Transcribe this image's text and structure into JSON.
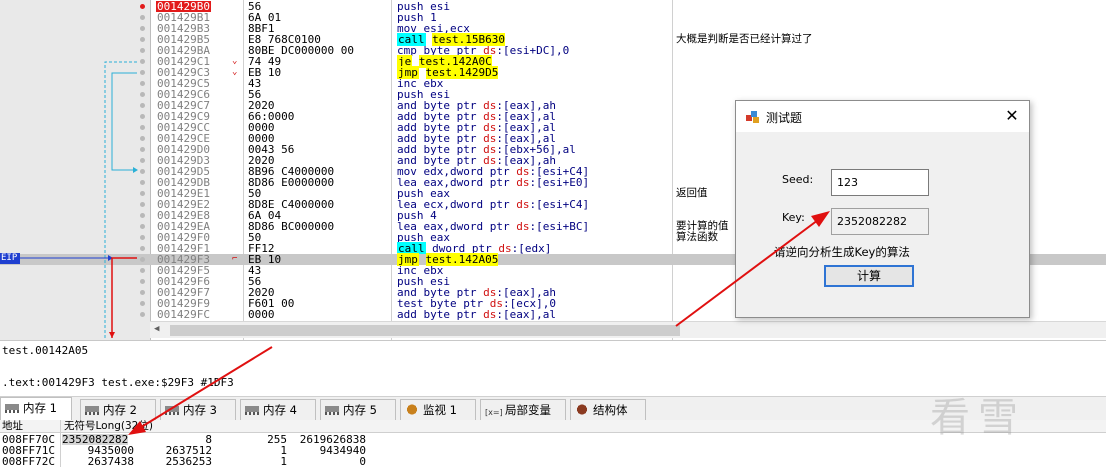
{
  "disasm": {
    "rows": [
      {
        "addr": "001429B0",
        "bytes": "56",
        "asm": "push esi",
        "comment": ""
      },
      {
        "addr": "001429B1",
        "bytes": "6A 01",
        "asm": "push 1",
        "comment": ""
      },
      {
        "addr": "001429B3",
        "bytes": "8BF1",
        "asm": "mov esi,ecx",
        "comment": ""
      },
      {
        "addr": "001429B5",
        "bytes": "E8 768C0100",
        "asm": "call test.15B630",
        "comment": "大概是判断是否已经计算过了"
      },
      {
        "addr": "001429BA",
        "bytes": "80BE DC000000 00",
        "asm": "cmp byte ptr ds:[esi+DC],0",
        "comment": ""
      },
      {
        "addr": "001429C1",
        "bytes": "74 49",
        "asm": "je test.142A0C",
        "comment": ""
      },
      {
        "addr": "001429C3",
        "bytes": "EB 10",
        "asm": "jmp test.1429D5",
        "comment": ""
      },
      {
        "addr": "001429C5",
        "bytes": "43",
        "asm": "inc ebx",
        "comment": ""
      },
      {
        "addr": "001429C6",
        "bytes": "56",
        "asm": "push esi",
        "comment": ""
      },
      {
        "addr": "001429C7",
        "bytes": "2020",
        "asm": "and byte ptr ds:[eax],ah",
        "comment": ""
      },
      {
        "addr": "001429C9",
        "bytes": "66:0000",
        "asm": "add byte ptr ds:[eax],al",
        "comment": ""
      },
      {
        "addr": "001429CC",
        "bytes": "0000",
        "asm": "add byte ptr ds:[eax],al",
        "comment": ""
      },
      {
        "addr": "001429CE",
        "bytes": "0000",
        "asm": "add byte ptr ds:[eax],al",
        "comment": ""
      },
      {
        "addr": "001429D0",
        "bytes": "0043 56",
        "asm": "add byte ptr ds:[ebx+56],al",
        "comment": ""
      },
      {
        "addr": "001429D3",
        "bytes": "2020",
        "asm": "and byte ptr ds:[eax],ah",
        "comment": ""
      },
      {
        "addr": "001429D5",
        "bytes": "8B96 C4000000",
        "asm": "mov edx,dword ptr ds:[esi+C4]",
        "comment": ""
      },
      {
        "addr": "001429DB",
        "bytes": "8D86 E0000000",
        "asm": "lea eax,dword ptr ds:[esi+E0]",
        "comment": ""
      },
      {
        "addr": "001429E1",
        "bytes": "50",
        "asm": "push eax",
        "comment": "返回值"
      },
      {
        "addr": "001429E2",
        "bytes": "8D8E C4000000",
        "asm": "lea ecx,dword ptr ds:[esi+C4]",
        "comment": ""
      },
      {
        "addr": "001429E8",
        "bytes": "6A 04",
        "asm": "push 4",
        "comment": ""
      },
      {
        "addr": "001429EA",
        "bytes": "8D86 BC000000",
        "asm": "lea eax,dword ptr ds:[esi+BC]",
        "comment": "要计算的值"
      },
      {
        "addr": "001429F0",
        "bytes": "50",
        "asm": "push eax",
        "comment": "算法函数"
      },
      {
        "addr": "001429F1",
        "bytes": "FF12",
        "asm": "call dword ptr ds:[edx]",
        "comment": ""
      },
      {
        "addr": "001429F3",
        "bytes": "EB 10",
        "asm": "jmp test.142A05",
        "comment": ""
      },
      {
        "addr": "001429F5",
        "bytes": "43",
        "asm": "inc ebx",
        "comment": ""
      },
      {
        "addr": "001429F6",
        "bytes": "56",
        "asm": "push esi",
        "comment": ""
      },
      {
        "addr": "001429F7",
        "bytes": "2020",
        "asm": "and byte ptr ds:[eax],ah",
        "comment": ""
      },
      {
        "addr": "001429F9",
        "bytes": "F601 00",
        "asm": "test byte ptr ds:[ecx],0",
        "comment": ""
      },
      {
        "addr": "001429FC",
        "bytes": "0000",
        "asm": "add byte ptr ds:[eax],al",
        "comment": ""
      }
    ],
    "eip_label": "EIP"
  },
  "info": {
    "line1": "test.00142A05",
    "line2": ".text:001429F3 test.exe:$29F3 #1DF3"
  },
  "tabs": [
    {
      "label": "内存 1"
    },
    {
      "label": "内存 2"
    },
    {
      "label": "内存 3"
    },
    {
      "label": "内存 4"
    },
    {
      "label": "内存 5"
    },
    {
      "label": "监视 1"
    },
    {
      "label": "局部变量"
    },
    {
      "label": "结构体"
    }
  ],
  "dump": {
    "headers": {
      "addr": "地址",
      "value": "无符号Long(32位)"
    },
    "rows": [
      {
        "addr": "008FF70C",
        "v0": "2352082282",
        "v1": "8",
        "v2": "255",
        "v3": "2619626838"
      },
      {
        "addr": "008FF71C",
        "v0": "9435000",
        "v1": "2637512",
        "v2": "1",
        "v3": "9434940"
      },
      {
        "addr": "008FF72C",
        "v0": "2637438",
        "v1": "2536253",
        "v2": "1",
        "v3": "0"
      }
    ]
  },
  "dialog": {
    "title": "测试题",
    "seed_label": "Seed:",
    "seed_value": "123",
    "key_label": "Key:",
    "key_value": "2352082282",
    "hint": "请逆向分析生成Key的算法",
    "button": "计算"
  },
  "watermark": "看雪",
  "colors": {
    "breakpoint_red": "#e21b1b",
    "eip_blue": "#1f3fd0",
    "call_cyan": "#00ffff",
    "jump_yellow": "#ffff00",
    "arrow_red": "#e01010"
  }
}
